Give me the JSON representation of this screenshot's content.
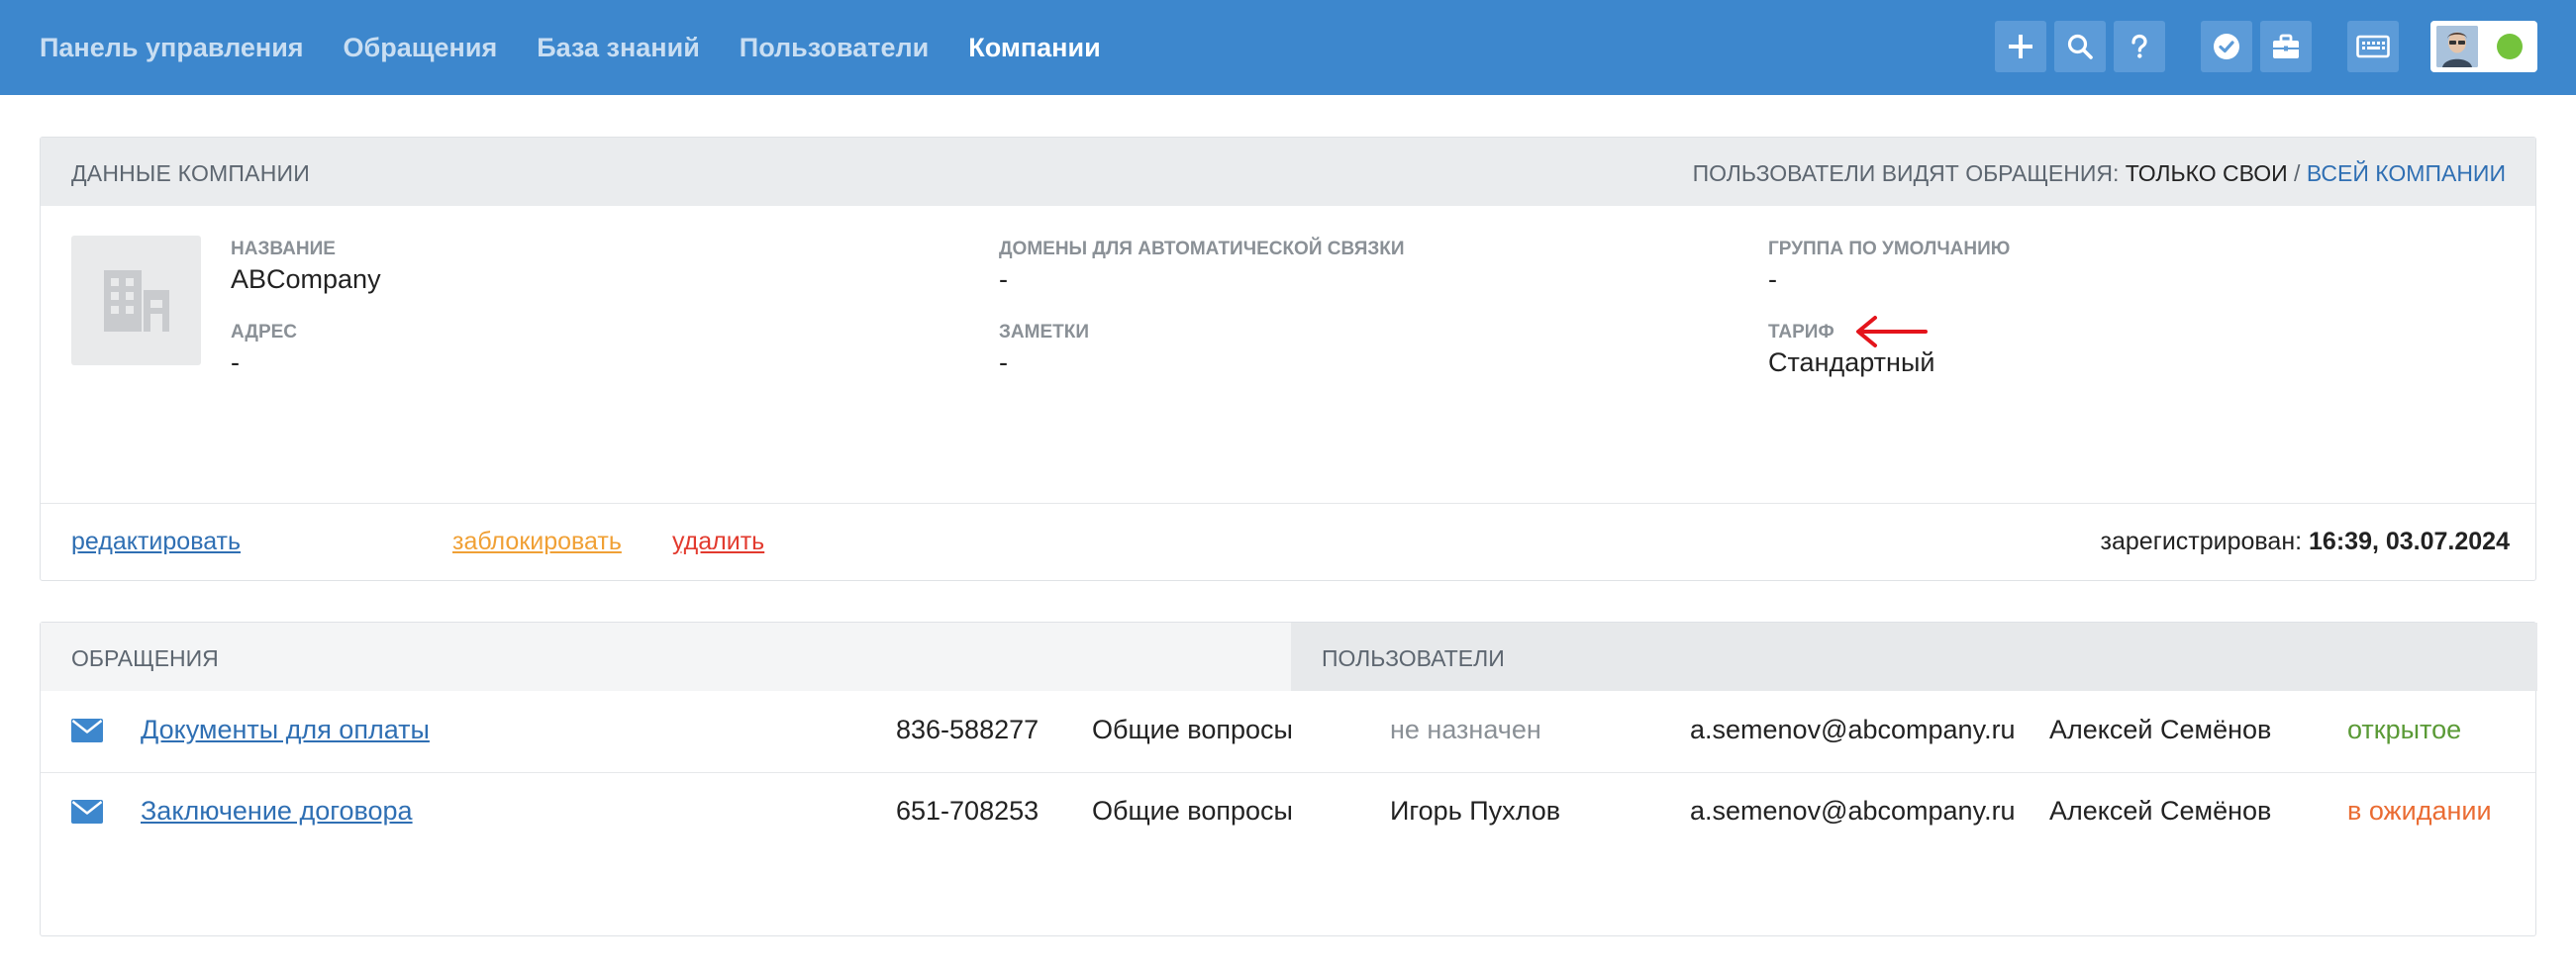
{
  "nav": {
    "items": [
      "Панель управления",
      "Обращения",
      "База знаний",
      "Пользователи",
      "Компании"
    ],
    "active": "Компании"
  },
  "toolbar": {
    "icons": [
      "plus-icon",
      "search-icon",
      "help-icon",
      "check-badge-icon",
      "briefcase-icon",
      "keyboard-icon"
    ],
    "user_status_color": "#74c33c"
  },
  "colors": {
    "topbar": "#3d87cd",
    "link": "#2f6fb3",
    "block": "#f0a035",
    "delete": "#e23a2e",
    "status_open": "#5a9a36",
    "status_waiting": "#ea6c33"
  },
  "company": {
    "panel_title": "Данные компании",
    "visibility": {
      "label": "Пользователи видят обращения:",
      "only_own": "Только свои",
      "separator": "/",
      "all_company": "Всей компании"
    },
    "fields": {
      "name_label": "Название",
      "name_value": "ABCompany",
      "address_label": "Адрес",
      "address_value": "-",
      "domains_label": "Домены для автоматической связки",
      "domains_value": "-",
      "notes_label": "Заметки",
      "notes_value": "-",
      "group_label": "Группа по умолчанию",
      "group_value": "-",
      "tariff_label": "Тариф",
      "tariff_value": "Стандартный"
    },
    "actions": {
      "edit": "редактировать",
      "block": "заблокировать",
      "delete": "удалить"
    },
    "registered_label": "зарегистрирован:",
    "registered_value": "16:39, 03.07.2024"
  },
  "tickets": {
    "tabs": [
      "Обращения",
      "Пользователи"
    ],
    "rows": [
      {
        "subject": "Документы для оплаты",
        "number": "836-588277",
        "category": "Общие вопросы",
        "assignee": "не назначен",
        "email": "a.semenov@abcompany.ru",
        "user": "Алексей Семёнов",
        "status": "открытое"
      },
      {
        "subject": "Заключение договора",
        "number": "651-708253",
        "category": "Общие вопросы",
        "assignee": "Игорь Пухлов",
        "email": "a.semenov@abcompany.ru",
        "user": "Алексей Семёнов",
        "status": "в ожидании"
      }
    ]
  }
}
